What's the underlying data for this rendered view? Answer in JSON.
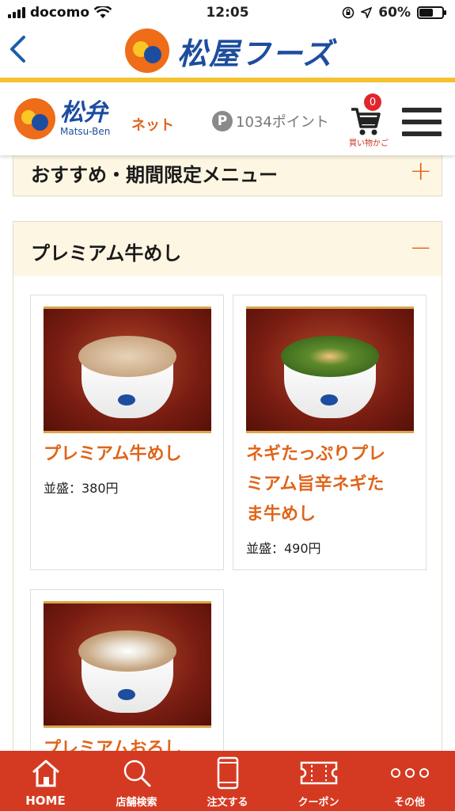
{
  "status_bar": {
    "carrier": "docomo",
    "time": "12:05",
    "battery": "60%",
    "battery_level": 0.6
  },
  "top_header": {
    "brand": "松屋フーズ",
    "back_icon": "chevron-left-icon"
  },
  "sub_header": {
    "logo_kanji": "松弁",
    "logo_romaji": "Matsu-Ben",
    "logo_suffix": "ネット",
    "points_symbol": "P",
    "points": "1034ポイント",
    "cart_count": "0",
    "cart_label": "買い物かご"
  },
  "sections": [
    {
      "title": "おすすめ・期間限定メニュー",
      "toggle": "+"
    },
    {
      "title": "プレミアム牛めし",
      "toggle": "−"
    }
  ],
  "products": [
    {
      "name_lines": [
        "プレミアム牛めし"
      ],
      "price": "並盛：380円"
    },
    {
      "name_lines": [
        "ネギたっぷりプレ",
        "ミアム旨辛ネギた",
        "ま牛めし"
      ],
      "price": "並盛：490円"
    },
    {
      "name_lines": [
        "プレミアムおろし"
      ],
      "price": ""
    }
  ],
  "bottom_nav": [
    {
      "label": "HOME",
      "icon": "home-icon"
    },
    {
      "label": "店舗検索",
      "icon": "search-icon"
    },
    {
      "label": "注文する",
      "icon": "phone-icon"
    },
    {
      "label": "クーポン",
      "icon": "ticket-icon"
    },
    {
      "label": "その他",
      "icon": "more-icon"
    }
  ],
  "colors": {
    "brand_blue": "#1d4d9f",
    "brand_orange": "#e0641a",
    "nav_red": "#d43a22",
    "gold": "#f2c230"
  }
}
